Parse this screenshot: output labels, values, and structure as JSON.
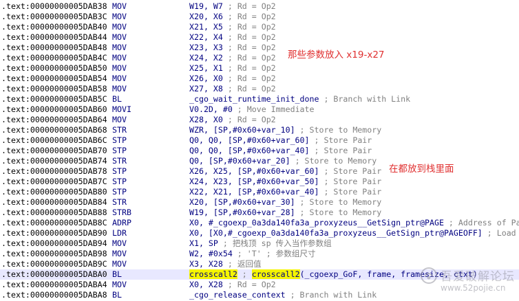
{
  "lines": [
    {
      "addr": ".text:00000000005DAB38",
      "mn": "MOV",
      "ops": "W19, W7",
      "comment": " ; Rd = Op2"
    },
    {
      "addr": ".text:00000000005DAB3C",
      "mn": "MOV",
      "ops": "X20, X6",
      "comment": " ; Rd = Op2"
    },
    {
      "addr": ".text:00000000005DAB40",
      "mn": "MOV",
      "ops": "X21, X5",
      "comment": " ; Rd = Op2"
    },
    {
      "addr": ".text:00000000005DAB44",
      "mn": "MOV",
      "ops": "X22, X4",
      "comment": " ; Rd = Op2"
    },
    {
      "addr": ".text:00000000005DAB48",
      "mn": "MOV",
      "ops": "X23, X3",
      "comment": " ; Rd = Op2"
    },
    {
      "addr": ".text:00000000005DAB4C",
      "mn": "MOV",
      "ops": "X24, X2",
      "comment": " ; Rd = Op2"
    },
    {
      "addr": ".text:00000000005DAB50",
      "mn": "MOV",
      "ops": "X25, X1",
      "comment": " ; Rd = Op2"
    },
    {
      "addr": ".text:00000000005DAB54",
      "mn": "MOV",
      "ops": "X26, X0",
      "comment": " ; Rd = Op2"
    },
    {
      "addr": ".text:00000000005DAB58",
      "mn": "MOV",
      "ops": "X27, X8",
      "comment": " ; Rd = Op2"
    },
    {
      "addr": ".text:00000000005DAB5C",
      "mn": "BL",
      "ops": "_cgo_wait_runtime_init_done",
      "comment": " ; Branch with Link"
    },
    {
      "addr": ".text:00000000005DAB60",
      "mn": "MOVI",
      "ops": "V0.2D, #0",
      "comment": " ; Move Immediate"
    },
    {
      "addr": ".text:00000000005DAB64",
      "mn": "MOV",
      "ops": "X28, X0",
      "comment": " ; Rd = Op2"
    },
    {
      "addr": ".text:00000000005DAB68",
      "mn": "STR",
      "ops": "WZR, [SP,#0x60+var_10]",
      "comment": " ; Store to Memory"
    },
    {
      "addr": ".text:00000000005DAB6C",
      "mn": "STP",
      "ops": "Q0, Q0, [SP,#0x60+var_60]",
      "comment": " ; Store Pair"
    },
    {
      "addr": ".text:00000000005DAB70",
      "mn": "STP",
      "ops": "Q0, Q0, [SP,#0x60+var_40]",
      "comment": " ; Store Pair"
    },
    {
      "addr": ".text:00000000005DAB74",
      "mn": "STR",
      "ops": "Q0, [SP,#0x60+var_20]",
      "comment": " ; Store to Memory"
    },
    {
      "addr": ".text:00000000005DAB78",
      "mn": "STP",
      "ops": "X26, X25, [SP,#0x60+var_60]",
      "comment": " ; Store Pair"
    },
    {
      "addr": ".text:00000000005DAB7C",
      "mn": "STP",
      "ops": "X24, X23, [SP,#0x60+var_50]",
      "comment": " ; Store Pair"
    },
    {
      "addr": ".text:00000000005DAB80",
      "mn": "STP",
      "ops": "X22, X21, [SP,#0x60+var_40]",
      "comment": " ; Store Pair"
    },
    {
      "addr": ".text:00000000005DAB84",
      "mn": "STR",
      "ops": "X20, [SP,#0x60+var_30]",
      "comment": " ; Store to Memory"
    },
    {
      "addr": ".text:00000000005DAB88",
      "mn": "STRB",
      "ops": "W19, [SP,#0x60+var_28]",
      "comment": " ; Store to Memory"
    },
    {
      "addr": ".text:00000000005DAB8C",
      "mn": "ADRP",
      "ops": "X0, #_cgoexp_0a3da140fa3a_proxyzeus__GetSign_ptr@PAGE",
      "comment": " ; Address of Pa"
    },
    {
      "addr": ".text:00000000005DAB90",
      "mn": "LDR",
      "ops": "X0, [X0,#_cgoexp_0a3da140fa3a_proxyzeus__GetSign_ptr@PAGEOFF]",
      "comment": " ; Load"
    },
    {
      "addr": ".text:00000000005DAB94",
      "mn": "MOV",
      "ops": "X1, SP",
      "comment": " ; 把栈顶 sp 传入当作参数组"
    },
    {
      "addr": ".text:00000000005DAB98",
      "mn": "MOV",
      "ops": "W2, #0x54",
      "comment": " ; 'T' ; 参数组尺寸"
    },
    {
      "addr": ".text:00000000005DAB9C",
      "mn": "MOV",
      "ops": "X3, X28",
      "comment": " ; 返回值"
    },
    {
      "addr": ".text:00000000005DABA0",
      "mn": "BL",
      "ops_hl": "crosscall2",
      "ops_mid": " ; ",
      "ops_hl2": "crosscall2",
      "ops_tail": "(_cgoexp_GoF, frame, framesize, ctxt)",
      "current": true
    },
    {
      "addr": ".text:00000000005DABA4",
      "mn": "MOV",
      "ops": "X0, X28",
      "comment": " ; Rd = Op2"
    },
    {
      "addr": ".text:00000000005DABA8",
      "mn": "BL",
      "ops": "_cgo_release_context",
      "comment": " ; Branch with Link"
    }
  ],
  "annotations": {
    "params_note": "那些参数放入 x19-x27",
    "stack_note": "在都放到栈里面"
  },
  "watermark": {
    "title": "吾爱破解论坛",
    "url": "www.52pojie.cn"
  },
  "colors": {
    "address": "#000000",
    "instruction": "#000080",
    "comment": "#808080",
    "highlight": "#f5f500",
    "annotation": "#e03030",
    "current_line": "#e8e8ff"
  }
}
